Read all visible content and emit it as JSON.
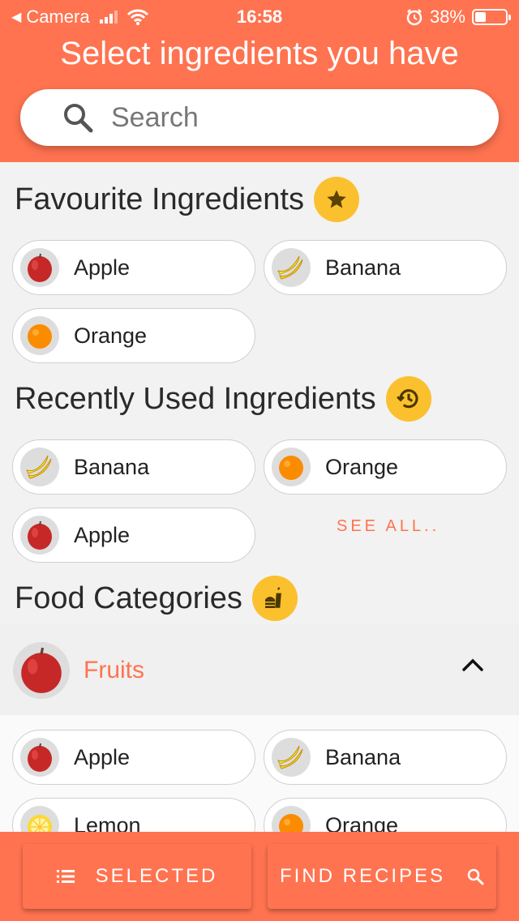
{
  "status": {
    "back_app": "Camera",
    "time": "16:58",
    "battery": "38%",
    "battery_level": 0.38
  },
  "header": {
    "title": "Select ingredients you have"
  },
  "search": {
    "placeholder": "Search"
  },
  "favourites": {
    "title": "Favourite Ingredients",
    "badge_icon": "star-icon",
    "items": [
      {
        "label": "Apple",
        "icon": "apple-icon"
      },
      {
        "label": "Banana",
        "icon": "banana-icon"
      },
      {
        "label": "Orange",
        "icon": "orange-icon"
      }
    ]
  },
  "recent": {
    "title": "Recently Used Ingredients",
    "badge_icon": "history-icon",
    "items": [
      {
        "label": "Banana",
        "icon": "banana-icon"
      },
      {
        "label": "Orange",
        "icon": "orange-icon"
      },
      {
        "label": "Apple",
        "icon": "apple-icon"
      }
    ],
    "see_all": "SEE ALL.."
  },
  "categories": {
    "title": "Food Categories",
    "badge_icon": "fast-food-icon",
    "expanded": {
      "label": "Fruits",
      "icon": "apple-icon",
      "items": [
        {
          "label": "Apple",
          "icon": "apple-icon"
        },
        {
          "label": "Banana",
          "icon": "banana-icon"
        },
        {
          "label": "Lemon",
          "icon": "lemon-icon"
        },
        {
          "label": "Orange",
          "icon": "orange-icon"
        }
      ]
    }
  },
  "bottom": {
    "selected_label": "SELECTED",
    "find_label": "FIND RECIPES"
  },
  "colors": {
    "primary": "#ff7350",
    "accent": "#fbc02d",
    "background": "#f2f2f2"
  }
}
